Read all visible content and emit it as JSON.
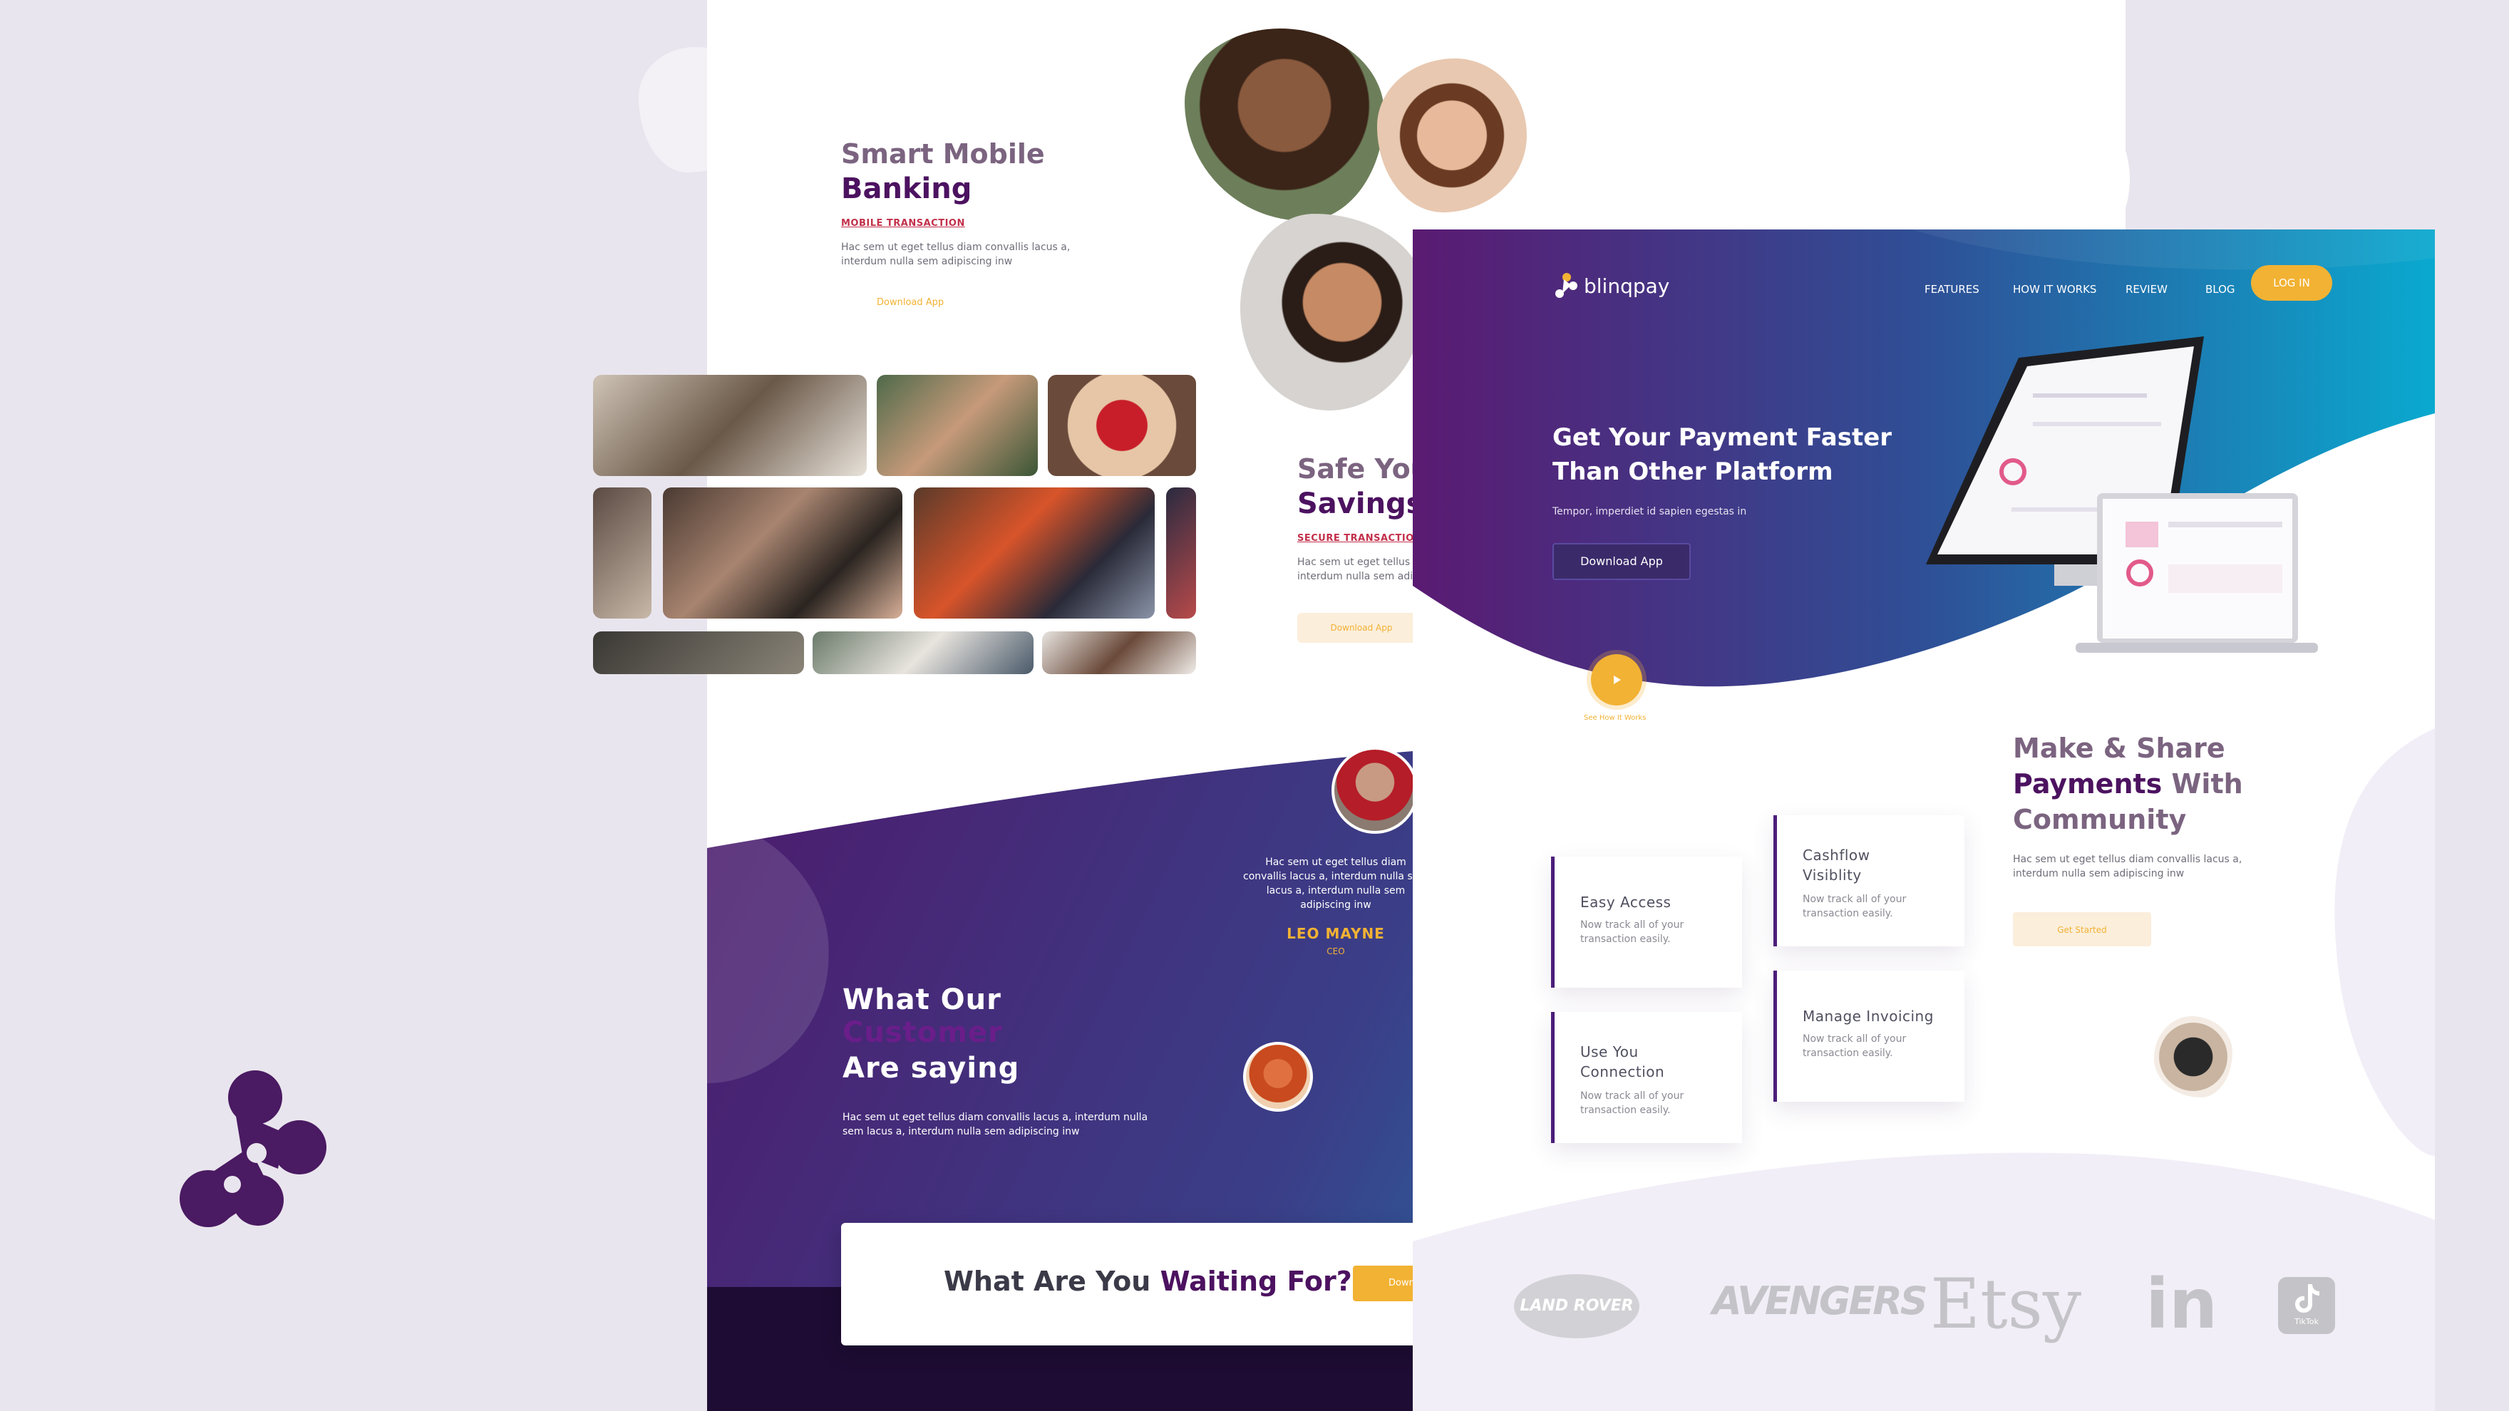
{
  "colors": {
    "background": "#e9e5ee",
    "brand_purple": "#4c1260",
    "accent_orange": "#f2b233",
    "teal": "#0aa9cf",
    "tag_red": "#c2304a"
  },
  "left_page": {
    "banking": {
      "title_line1": "Smart Mobile",
      "title_line2": "Banking",
      "tag": "MOBILE TRANSACTION",
      "desc": "Hac sem ut eget tellus diam convallis lacus a, interdum nulla sem adipiscing inw",
      "button": "Download App"
    },
    "savings": {
      "title_line1": "Safe Your",
      "title_line2": "Savings",
      "tag": "SECURE TRANSACTION",
      "desc": "Hac sem ut eget tellus diam convallis lacus a, interdum nulla sem adipiscing inw",
      "button": "Download App"
    },
    "testimonials": {
      "title_part1": "What Our",
      "title_highlight": "Customer",
      "title_part2": "Are saying",
      "desc": "Hac sem ut eget tellus diam convallis lacus a, interdum nulla sem lacus a, interdum nulla sem adipiscing inw",
      "quote": "Hac sem ut eget tellus diam convallis lacus a, interdum nulla sem lacus a, interdum nulla sem adipiscing inw",
      "person_name": "LEO MAYNE",
      "person_role": "CEO"
    },
    "cta": {
      "text_part1": "What Are You",
      "text_highlight": "Waiting For?",
      "button": "Download"
    }
  },
  "right_page": {
    "logo_text": "blinqpay",
    "nav": [
      {
        "label": "FEATURES"
      },
      {
        "label": "HOW IT WORKS"
      },
      {
        "label": "REVIEW"
      },
      {
        "label": "BLOG"
      }
    ],
    "login_button": "LOG IN",
    "hero": {
      "title_line1": "Get Your Payment Faster",
      "title_line2": "Than Other Platform",
      "subtitle": "Tempor, imperdiet id sapien egestas in",
      "button": "Download App",
      "video_label": "See How It Works"
    },
    "community": {
      "title_line1": "Make & Share",
      "title_highlight": "Payments",
      "title_rest": "With",
      "title_line3": "Community",
      "desc": "Hac sem ut eget tellus diam convallis lacus a, interdum nulla sem adipiscing inw",
      "button": "Get Started"
    },
    "features": [
      {
        "title": "Easy Access",
        "desc": "Now track all of your transaction easily."
      },
      {
        "title": "Cashflow Visiblity",
        "desc": "Now track all of your transaction easily."
      },
      {
        "title": "Use You Connection",
        "desc": "Now track all of your transaction easily."
      },
      {
        "title": "Manage Invoicing",
        "desc": "Now track all of your transaction easily."
      }
    ],
    "brand_logos": [
      {
        "name": "land-rover",
        "text": "LAND ROVER"
      },
      {
        "name": "avengers",
        "text": "AVENGERS"
      },
      {
        "name": "etsy",
        "text": "Etsy"
      },
      {
        "name": "linkedin",
        "text": "in"
      },
      {
        "name": "tiktok",
        "text": "TikTok"
      }
    ]
  }
}
